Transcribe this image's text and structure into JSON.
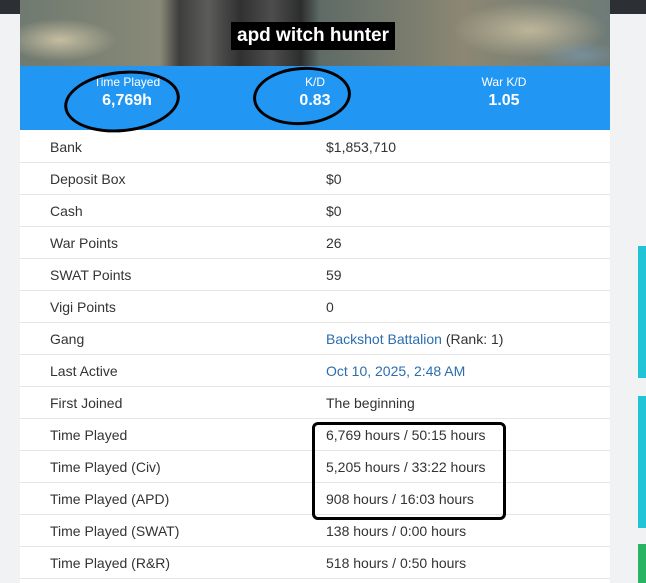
{
  "profile": {
    "name": "apd witch hunter"
  },
  "stats": [
    {
      "label": "Time Played",
      "value": "6,769h"
    },
    {
      "label": "K/D",
      "value": "0.83"
    },
    {
      "label": "War K/D",
      "value": "1.05"
    }
  ],
  "rows": [
    {
      "key": "Bank",
      "value": "$1,853,710"
    },
    {
      "key": "Deposit Box",
      "value": "$0"
    },
    {
      "key": "Cash",
      "value": "$0"
    },
    {
      "key": "War Points",
      "value": "26"
    },
    {
      "key": "SWAT Points",
      "value": "59"
    },
    {
      "key": "Vigi Points",
      "value": "0"
    },
    {
      "key": "Gang",
      "value_link": "Backshot Battalion",
      "value_suffix": " (Rank: 1)"
    },
    {
      "key": "Last Active",
      "value_link": "Oct 10, 2025, 2:48 AM"
    },
    {
      "key": "First Joined",
      "value": "The beginning"
    },
    {
      "key": "Time Played",
      "value": "6,769 hours / 50:15 hours"
    },
    {
      "key": "Time Played (Civ)",
      "value": "5,205 hours / 33:22 hours"
    },
    {
      "key": "Time Played (APD)",
      "value": "908 hours / 16:03 hours"
    },
    {
      "key": "Time Played (SWAT)",
      "value": "138 hours / 0:00 hours"
    },
    {
      "key": "Time Played (R&R)",
      "value": "518 hours / 0:50 hours"
    }
  ],
  "colors": {
    "stats_bar": "#2196f3",
    "link": "#2a6db0",
    "side_accent_teal": "#20c4d6",
    "side_accent_green": "#28b463"
  }
}
